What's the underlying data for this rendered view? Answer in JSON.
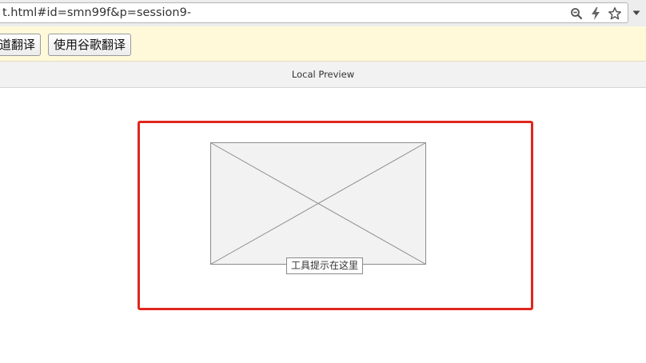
{
  "browser": {
    "url": "t.html#id=smn99f&p=session9-",
    "icons": [
      "zoom-icon",
      "lightning-icon",
      "star-icon",
      "chevron-down-icon"
    ]
  },
  "translate_bar": {
    "buttons": [
      {
        "label": "道翻译"
      },
      {
        "label": "使用谷歌翻译"
      }
    ]
  },
  "preview": {
    "title": "Local Preview"
  },
  "canvas": {
    "frame_color": "#e0261e",
    "image_placeholder_icon": "image-placeholder-icon",
    "tooltip": "工具提示在这里"
  }
}
